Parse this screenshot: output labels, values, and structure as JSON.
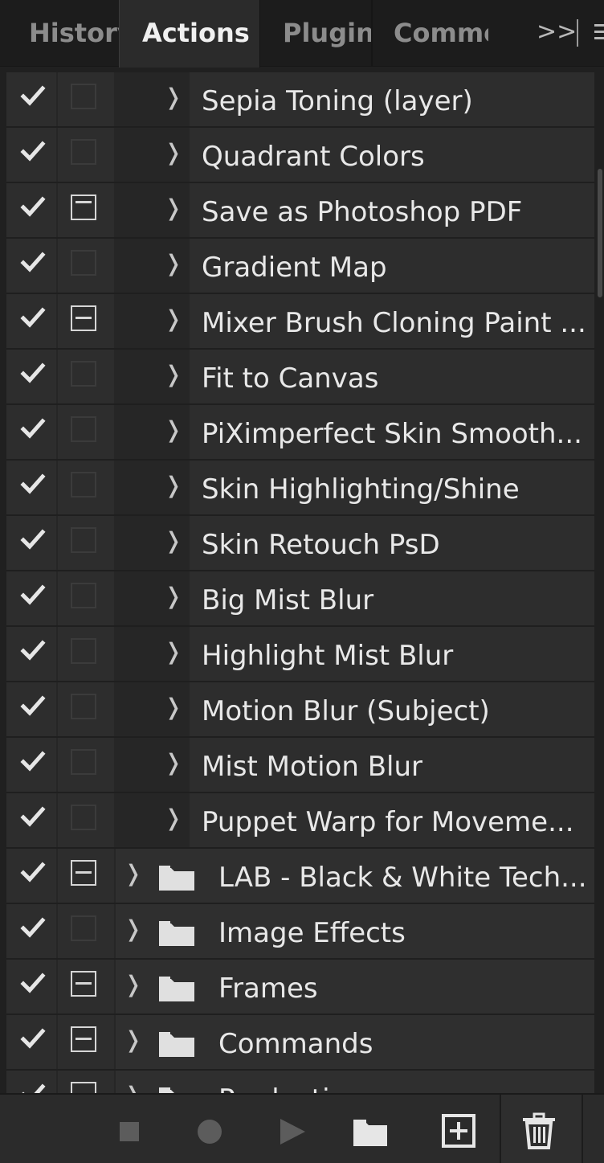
{
  "tabs": [
    {
      "label": "History",
      "active": false
    },
    {
      "label": "Actions",
      "active": true
    },
    {
      "label": "Plugins",
      "active": false
    },
    {
      "label": "Comments",
      "active": false
    }
  ],
  "tab_overflow_label": ">>",
  "rows": [
    {
      "label": "Sepia Toning (layer)",
      "checked": true,
      "dialog": "off",
      "type": "action"
    },
    {
      "label": "Quadrant Colors",
      "checked": true,
      "dialog": "off",
      "type": "action"
    },
    {
      "label": "Save as Photoshop PDF",
      "checked": true,
      "dialog": "on",
      "type": "action"
    },
    {
      "label": "Gradient Map",
      "checked": true,
      "dialog": "off",
      "type": "action"
    },
    {
      "label": "Mixer Brush Cloning Paint ...",
      "checked": true,
      "dialog": "partial",
      "type": "action"
    },
    {
      "label": "Fit to Canvas",
      "checked": true,
      "dialog": "off",
      "type": "action"
    },
    {
      "label": "PiXimperfect Skin Smooth...",
      "checked": true,
      "dialog": "off",
      "type": "action"
    },
    {
      "label": "Skin Highlighting/Shine",
      "checked": true,
      "dialog": "off",
      "type": "action"
    },
    {
      "label": "Skin Retouch PsD",
      "checked": true,
      "dialog": "off",
      "type": "action"
    },
    {
      "label": "Big Mist Blur",
      "checked": true,
      "dialog": "off",
      "type": "action"
    },
    {
      "label": "Highlight Mist Blur",
      "checked": true,
      "dialog": "off",
      "type": "action"
    },
    {
      "label": "Motion Blur (Subject)",
      "checked": true,
      "dialog": "off",
      "type": "action"
    },
    {
      "label": "Mist Motion Blur",
      "checked": true,
      "dialog": "off",
      "type": "action"
    },
    {
      "label": "Puppet Warp for Moveme...",
      "checked": true,
      "dialog": "off",
      "type": "action"
    },
    {
      "label": "LAB - Black & White Tech...",
      "checked": true,
      "dialog": "partial",
      "type": "set"
    },
    {
      "label": "Image Effects",
      "checked": true,
      "dialog": "off",
      "type": "set"
    },
    {
      "label": "Frames",
      "checked": true,
      "dialog": "partial",
      "type": "set"
    },
    {
      "label": "Commands",
      "checked": true,
      "dialog": "partial",
      "type": "set"
    },
    {
      "label": "Production",
      "checked": true,
      "dialog": "partial",
      "type": "set"
    }
  ],
  "footer": {
    "buttons": [
      "stop-icon",
      "record-icon",
      "play-icon",
      "new-set-icon",
      "new-action-icon",
      "trash-icon"
    ]
  },
  "colors": {
    "panel_bg": "#262626",
    "row_bg": "#2d2d2d",
    "text": "#e8e8e8",
    "tab_inactive": "#8c8c8c"
  }
}
